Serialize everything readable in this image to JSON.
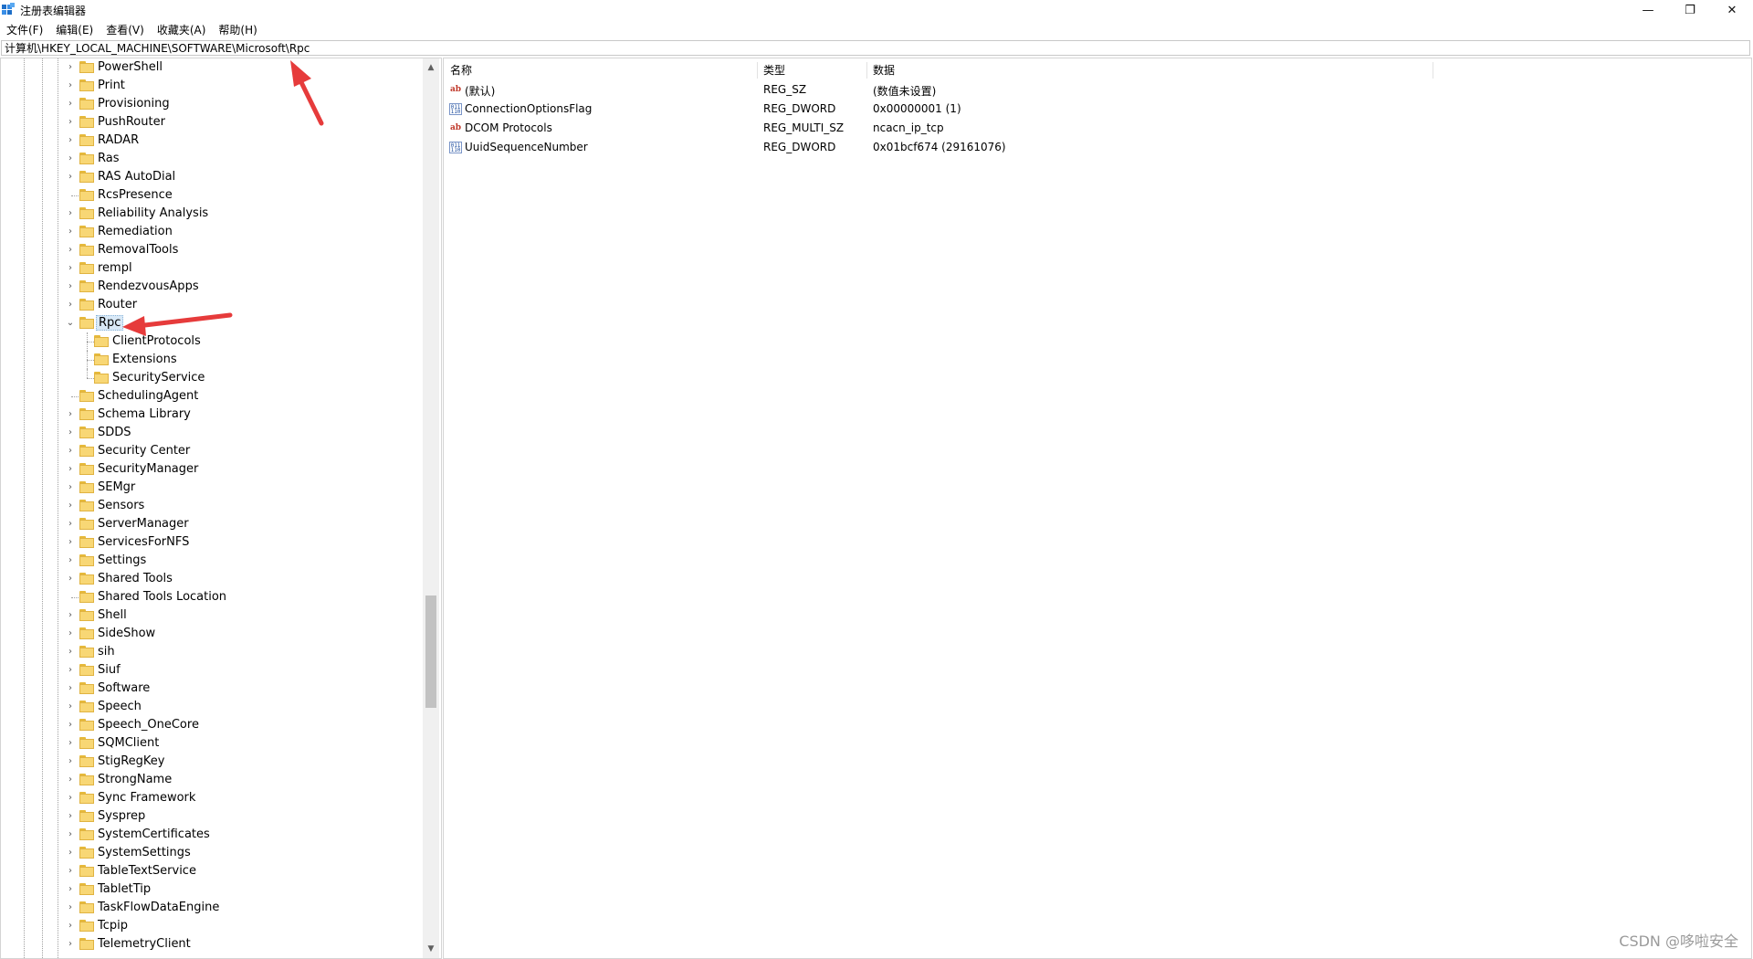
{
  "window": {
    "title": "注册表编辑器",
    "app_icon": "regedit-icon",
    "controls": {
      "minimize": "—",
      "maximize": "❐",
      "close": "✕"
    }
  },
  "menu": [
    "文件(F)",
    "编辑(E)",
    "查看(V)",
    "收藏夹(A)",
    "帮助(H)"
  ],
  "address": "计算机\\HKEY_LOCAL_MACHINE\\SOFTWARE\\Microsoft\\Rpc",
  "tree": {
    "items": [
      {
        "label": "PowerShell",
        "level": 0,
        "expandable": true
      },
      {
        "label": "Print",
        "level": 0,
        "expandable": true
      },
      {
        "label": "Provisioning",
        "level": 0,
        "expandable": true
      },
      {
        "label": "PushRouter",
        "level": 0,
        "expandable": true
      },
      {
        "label": "RADAR",
        "level": 0,
        "expandable": true
      },
      {
        "label": "Ras",
        "level": 0,
        "expandable": true
      },
      {
        "label": "RAS AutoDial",
        "level": 0,
        "expandable": true
      },
      {
        "label": "RcsPresence",
        "level": 0,
        "expandable": false
      },
      {
        "label": "Reliability Analysis",
        "level": 0,
        "expandable": true
      },
      {
        "label": "Remediation",
        "level": 0,
        "expandable": true
      },
      {
        "label": "RemovalTools",
        "level": 0,
        "expandable": true
      },
      {
        "label": "rempl",
        "level": 0,
        "expandable": true
      },
      {
        "label": "RendezvousApps",
        "level": 0,
        "expandable": true
      },
      {
        "label": "Router",
        "level": 0,
        "expandable": true
      },
      {
        "label": "Rpc",
        "level": 0,
        "expanded": true,
        "selected": true
      },
      {
        "label": "ClientProtocols",
        "level": 1
      },
      {
        "label": "Extensions",
        "level": 1
      },
      {
        "label": "SecurityService",
        "level": 1
      },
      {
        "label": "SchedulingAgent",
        "level": 0,
        "expandable": false
      },
      {
        "label": "Schema Library",
        "level": 0,
        "expandable": true
      },
      {
        "label": "SDDS",
        "level": 0,
        "expandable": true
      },
      {
        "label": "Security Center",
        "level": 0,
        "expandable": true
      },
      {
        "label": "SecurityManager",
        "level": 0,
        "expandable": true
      },
      {
        "label": "SEMgr",
        "level": 0,
        "expandable": true
      },
      {
        "label": "Sensors",
        "level": 0,
        "expandable": true
      },
      {
        "label": "ServerManager",
        "level": 0,
        "expandable": true
      },
      {
        "label": "ServicesForNFS",
        "level": 0,
        "expandable": true
      },
      {
        "label": "Settings",
        "level": 0,
        "expandable": true
      },
      {
        "label": "Shared Tools",
        "level": 0,
        "expandable": true
      },
      {
        "label": "Shared Tools Location",
        "level": 0,
        "expandable": false
      },
      {
        "label": "Shell",
        "level": 0,
        "expandable": true
      },
      {
        "label": "SideShow",
        "level": 0,
        "expandable": true
      },
      {
        "label": "sih",
        "level": 0,
        "expandable": true
      },
      {
        "label": "Siuf",
        "level": 0,
        "expandable": true
      },
      {
        "label": "Software",
        "level": 0,
        "expandable": true
      },
      {
        "label": "Speech",
        "level": 0,
        "expandable": true
      },
      {
        "label": "Speech_OneCore",
        "level": 0,
        "expandable": true
      },
      {
        "label": "SQMClient",
        "level": 0,
        "expandable": true
      },
      {
        "label": "StigRegKey",
        "level": 0,
        "expandable": true
      },
      {
        "label": "StrongName",
        "level": 0,
        "expandable": true
      },
      {
        "label": "Sync Framework",
        "level": 0,
        "expandable": true
      },
      {
        "label": "Sysprep",
        "level": 0,
        "expandable": true
      },
      {
        "label": "SystemCertificates",
        "level": 0,
        "expandable": true
      },
      {
        "label": "SystemSettings",
        "level": 0,
        "expandable": true
      },
      {
        "label": "TableTextService",
        "level": 0,
        "expandable": true
      },
      {
        "label": "TabletTip",
        "level": 0,
        "expandable": true
      },
      {
        "label": "TaskFlowDataEngine",
        "level": 0,
        "expandable": true
      },
      {
        "label": "Tcpip",
        "level": 0,
        "expandable": true
      },
      {
        "label": "TelemetryClient",
        "level": 0,
        "expandable": true
      }
    ]
  },
  "values": {
    "columns": [
      "名称",
      "类型",
      "数据"
    ],
    "rows": [
      {
        "icon": "string-value-icon",
        "name": "(默认)",
        "type": "REG_SZ",
        "data": "(数值未设置)"
      },
      {
        "icon": "binary-value-icon",
        "name": "ConnectionOptionsFlag",
        "type": "REG_DWORD",
        "data": "0x00000001 (1)"
      },
      {
        "icon": "string-value-icon",
        "name": "DCOM Protocols",
        "type": "REG_MULTI_SZ",
        "data": "ncacn_ip_tcp"
      },
      {
        "icon": "binary-value-icon",
        "name": "UuidSequenceNumber",
        "type": "REG_DWORD",
        "data": "0x01bcf674 (29161076)"
      }
    ]
  },
  "watermark": "CSDN @哆啦安全",
  "colors": {
    "annotation_arrow": "#e63b3b",
    "folder": "#f8d775",
    "selection": "#d9e9f7"
  }
}
